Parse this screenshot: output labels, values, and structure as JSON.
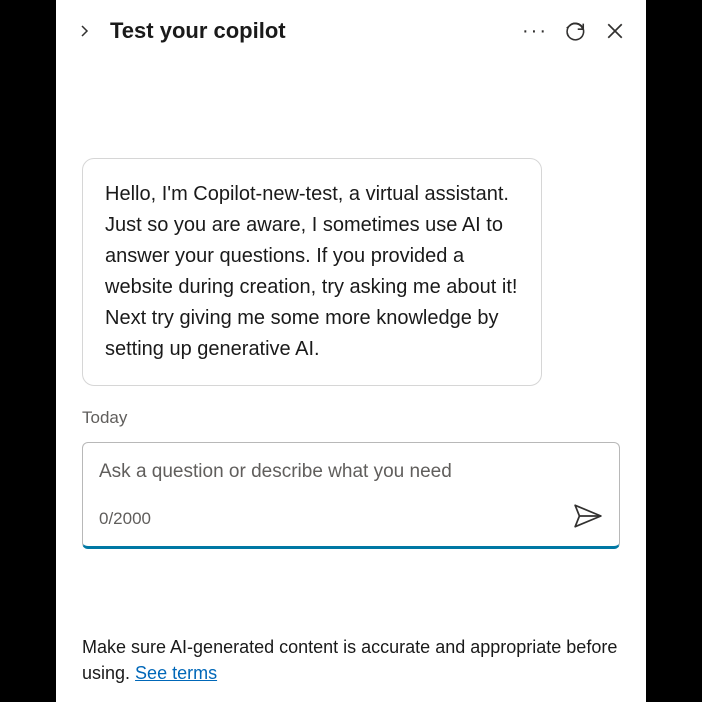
{
  "header": {
    "title": "Test your copilot"
  },
  "chat": {
    "greeting": "Hello, I'm Copilot-new-test, a virtual assistant. Just so you are aware, I sometimes use AI to answer your questions. If you provided a website during creation, try asking me about it! Next try giving me some more knowledge by setting up generative AI.",
    "date_label": "Today"
  },
  "input": {
    "placeholder": "Ask a question or describe what you need",
    "char_count": "0/2000"
  },
  "disclaimer": {
    "text": "Make sure AI-generated content is accurate and appropriate before using. ",
    "link_text": "See terms"
  }
}
